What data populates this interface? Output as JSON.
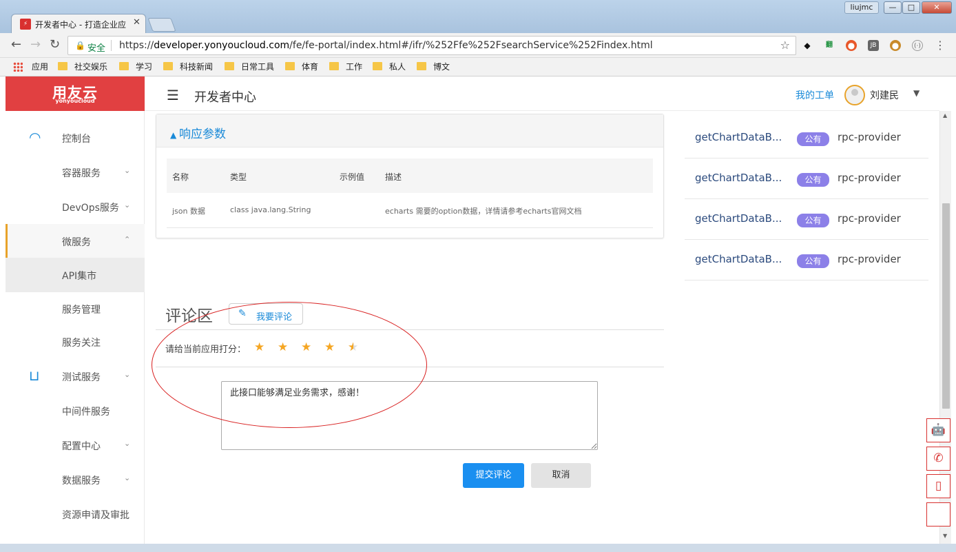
{
  "browser": {
    "tab_title": "开发者中心 - 打造企业应",
    "window_user": "liujmc",
    "secure_label": "安全",
    "url_prefix": "https://",
    "url_domain": "developer.yonyoucloud.com",
    "url_path": "/fe/fe-portal/index.html#/ifr/%252Ffe%252FsearchService%252Findex.html",
    "bookmarks": [
      "应用",
      "社交娱乐",
      "学习",
      "科技新闻",
      "日常工具",
      "体育",
      "工作",
      "私人",
      "博文"
    ]
  },
  "header": {
    "logo_main": "用友云",
    "logo_sub": "yonyoucloud",
    "page_title": "开发者中心",
    "my_tickets": "我的工单",
    "username": "刘建民"
  },
  "sidebar": {
    "items": [
      {
        "label": "控制台"
      },
      {
        "label": "容器服务"
      },
      {
        "label": "DevOps服务"
      },
      {
        "label": "微服务"
      },
      {
        "label": "API集市"
      },
      {
        "label": "服务管理"
      },
      {
        "label": "服务关注"
      },
      {
        "label": "测试服务"
      },
      {
        "label": "中间件服务"
      },
      {
        "label": "配置中心"
      },
      {
        "label": "数据服务"
      },
      {
        "label": "资源申请及审批"
      }
    ]
  },
  "response_params": {
    "title": "响应参数",
    "columns": [
      "名称",
      "类型",
      "示例值",
      "描述"
    ],
    "rows": [
      {
        "name": "json 数据",
        "type": "class java.lang.String",
        "example": "",
        "desc": "echarts 需要的option数据，详情请参考echarts官网文档"
      }
    ]
  },
  "comments": {
    "title": "评论区",
    "write_button": "我要评论",
    "rate_label": "请给当前应用打分：",
    "rating": 4.5,
    "rating_max": 5,
    "textarea_value": "此接口能够满足业务需求，感谢！",
    "submit": "提交评论",
    "cancel": "取消"
  },
  "api_list": [
    {
      "name": "getChartDataB...",
      "badge": "公有",
      "provider": "rpc-provider"
    },
    {
      "name": "getChartDataB...",
      "badge": "公有",
      "provider": "rpc-provider"
    },
    {
      "name": "getChartDataB...",
      "badge": "公有",
      "provider": "rpc-provider"
    },
    {
      "name": "getChartDataB...",
      "badge": "公有",
      "provider": "rpc-provider"
    }
  ],
  "colors": {
    "brand": "#e14041",
    "link": "#1a8ad8",
    "primary_button": "#1a8ff0",
    "badge": "#8c80e8",
    "star": "#f5a623",
    "annotation_ellipse": "#d81e1e"
  }
}
